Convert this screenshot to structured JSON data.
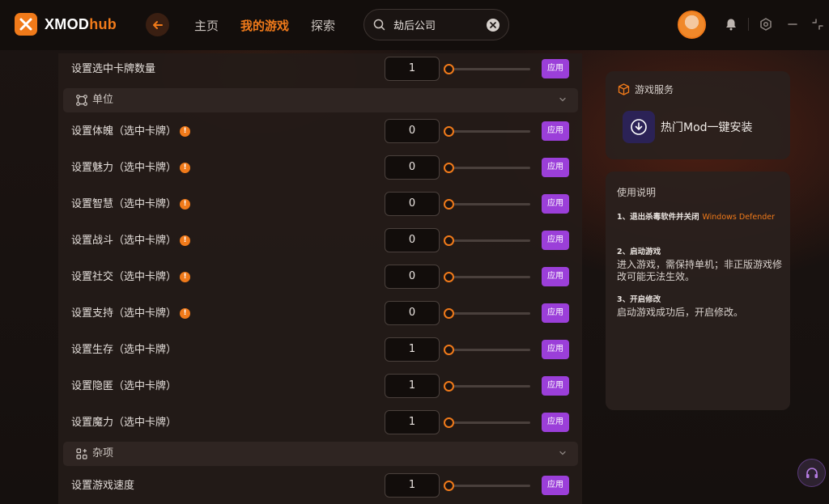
{
  "brand": {
    "name": "XMOD",
    "suffix": "hub",
    "accent": "#f07a1a",
    "apply_color": "#9b3fd9"
  },
  "nav": {
    "home": "主页",
    "my_games": "我的游戏",
    "explore": "探索"
  },
  "search": {
    "value": "劫后公司"
  },
  "mods": {
    "top_row": {
      "label": "设置选中卡牌数量",
      "value": "1",
      "apply": "应用"
    },
    "section_unit": "单位",
    "unit_rows": [
      {
        "label": "设置体魄（选中卡牌）",
        "value": "0",
        "warn": true
      },
      {
        "label": "设置魅力（选中卡牌）",
        "value": "0",
        "warn": true
      },
      {
        "label": "设置智慧（选中卡牌）",
        "value": "0",
        "warn": true
      },
      {
        "label": "设置战斗（选中卡牌）",
        "value": "0",
        "warn": true
      },
      {
        "label": "设置社交（选中卡牌）",
        "value": "0",
        "warn": true
      },
      {
        "label": "设置支持（选中卡牌）",
        "value": "0",
        "warn": true
      },
      {
        "label": "设置生存（选中卡牌）",
        "value": "1",
        "warn": false
      },
      {
        "label": "设置隐匿（选中卡牌）",
        "value": "1",
        "warn": false
      },
      {
        "label": "设置魔力（选中卡牌）",
        "value": "1",
        "warn": false
      }
    ],
    "section_misc": "杂项",
    "misc_rows": [
      {
        "label": "设置游戏速度",
        "value": "1"
      }
    ],
    "apply_label": "应用",
    "warn_glyph": "!"
  },
  "service": {
    "title": "游戏服务",
    "item": "热门Mod一键安装"
  },
  "help": {
    "title": "使用说明",
    "step1_title": "1、退出杀毒软件并关闭",
    "step1_highlight": "Windows Defender",
    "step2_title": "2、启动游戏",
    "step2_desc": "进入游戏，需保持单机；非正版游戏修改可能无法生效。",
    "step3_title": "3、开启修改",
    "step3_desc": "启动游戏成功后，开启修改。"
  }
}
